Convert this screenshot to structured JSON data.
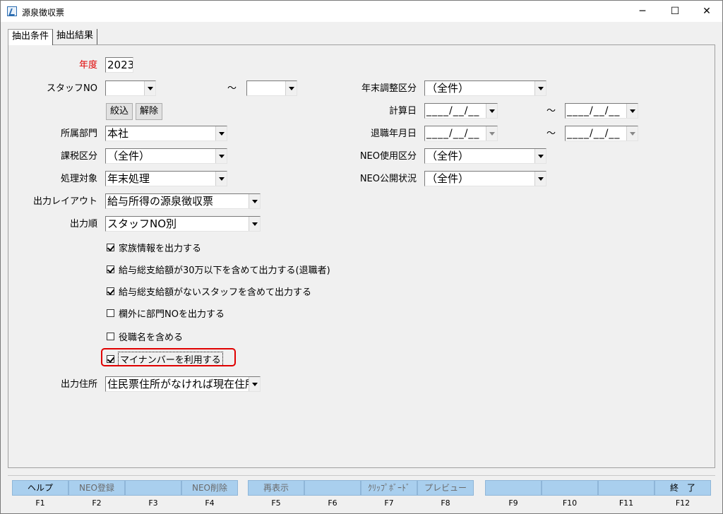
{
  "window": {
    "title": "源泉徴収票"
  },
  "tabs": [
    "抽出条件",
    "抽出結果"
  ],
  "form": {
    "year_label": "年度",
    "year_value": "2023",
    "staff_label": "スタッフNO",
    "staff_from": "",
    "tilde": "～",
    "staff_to": "",
    "narrow_button": "絞込",
    "release_button": "解除",
    "dept_label": "所属部門",
    "dept_value": "本社",
    "tax_label": "課税区分",
    "tax_value": "（全件）",
    "target_label": "処理対象",
    "target_value": "年末処理",
    "layout_label": "出力レイアウト",
    "layout_value": "給与所得の源泉徴収票",
    "order_label": "出力順",
    "order_value": "スタッフNO別",
    "yearend_label": "年末調整区分",
    "yearend_value": "（全件）",
    "calc_label": "計算日",
    "calc_from": "____/__/__",
    "calc_to": "____/__/__",
    "retire_label": "退職年月日",
    "retire_from": "____/__/__",
    "retire_to": "____/__/__",
    "neo_use_label": "NEO使用区分",
    "neo_use_value": "（全件）",
    "neo_pub_label": "NEO公開状況",
    "neo_pub_value": "（全件）",
    "address_label": "出力住所",
    "address_value": "住民票住所がなければ現在住所"
  },
  "checks": [
    {
      "label": "家族情報を出力する",
      "checked": true
    },
    {
      "label": "給与総支給額が30万以下を含めて出力する(退職者)",
      "checked": true
    },
    {
      "label": "給与総支給額がないスタッフを含めて出力する",
      "checked": true
    },
    {
      "label": "欄外に部門NOを出力する",
      "checked": false
    },
    {
      "label": "役職名を含める",
      "checked": false
    },
    {
      "label": "マイナンバーを利用する",
      "checked": true
    }
  ],
  "fkeys": [
    {
      "label": "ヘルプ",
      "key": "F1"
    },
    {
      "label": "NEO登録",
      "key": "F2"
    },
    {
      "label": "",
      "key": "F3"
    },
    {
      "label": "NEO削除",
      "key": "F4"
    },
    {
      "label": "再表示",
      "key": "F5"
    },
    {
      "label": "",
      "key": "F6"
    },
    {
      "label": "ｸﾘｯﾌﾟﾎﾞｰﾄﾞ",
      "key": "F7"
    },
    {
      "label": "プレビュー",
      "key": "F8"
    },
    {
      "label": "",
      "key": "F9"
    },
    {
      "label": "",
      "key": "F10"
    },
    {
      "label": "",
      "key": "F11"
    },
    {
      "label": "終　了",
      "key": "F12"
    }
  ]
}
